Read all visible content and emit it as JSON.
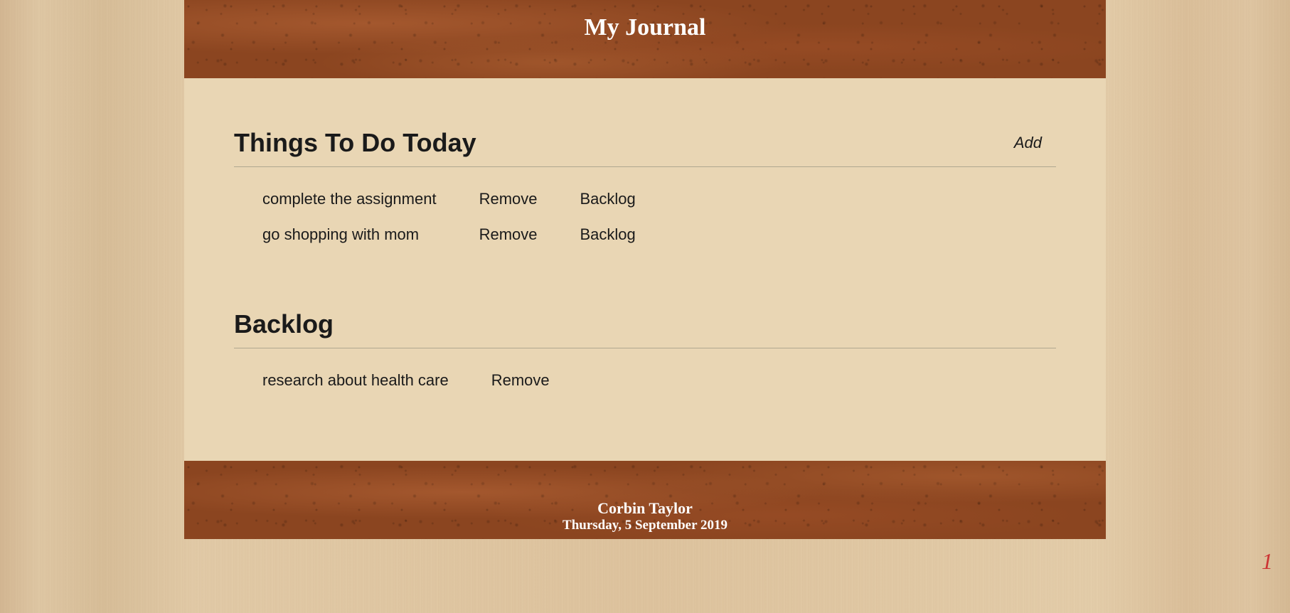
{
  "header": {
    "title": "My Journal"
  },
  "todo": {
    "title": "Things To Do Today",
    "add_label": "Add",
    "items": [
      {
        "text": "complete the assignment",
        "remove_label": "Remove",
        "backlog_label": "Backlog"
      },
      {
        "text": "go shopping with mom",
        "remove_label": "Remove",
        "backlog_label": "Backlog"
      }
    ]
  },
  "backlog": {
    "title": "Backlog",
    "items": [
      {
        "text": "research about health care",
        "remove_label": "Remove"
      }
    ]
  },
  "footer": {
    "name": "Corbin Taylor",
    "date": "Thursday, 5 September 2019"
  },
  "page_number": "1"
}
